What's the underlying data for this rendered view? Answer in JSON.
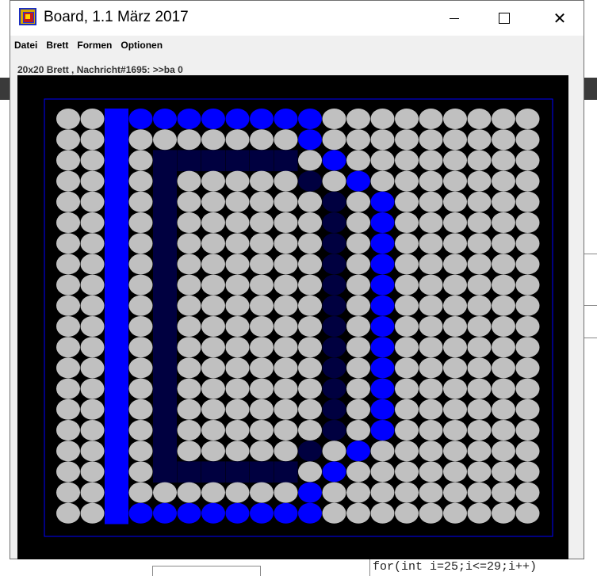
{
  "window": {
    "title": "Board, 1.1 März 2017",
    "controls": {
      "minimize": "minimize",
      "maximize": "maximize",
      "close": "✕"
    }
  },
  "menu": {
    "items": [
      "Datei",
      "Brett",
      "Formen",
      "Optionen"
    ]
  },
  "status": {
    "text": "20x20 Brett , Nachricht#1695: >>ba 0"
  },
  "background": {
    "code_snippet": "for(int i=25;i<=29;i++)"
  },
  "board": {
    "rows": 20,
    "cols": 20,
    "cell_colors": {
      "gray": "#c0c0c0",
      "blue": "#0000ff",
      "navy": "#000040"
    },
    "background_color": "#000000",
    "frame_color": "#0000ff",
    "grid": [
      "..BbBBBBBBB.........",
      "..B.......B.........",
      "..B.nnnnnn.B........",
      "..B.n.....n.B.......",
      "..B.n......n.B......",
      "..B.n......n.B......",
      "..B.n......n.B......",
      "..B.n......n.B......",
      "..B.n......n.B......",
      "..B.n......n.B......",
      "..B.n......n.B......",
      "..B.n......n.B......",
      "..B.n......n.B......",
      "..B.n......n.B......",
      "..B.n......n.B......",
      "..B.n......n.B......",
      "..B.n.....n.B.......",
      "..B.nnnnnn.B........",
      "..B.......B.........",
      "..BBBBBBBBB........."
    ]
  }
}
